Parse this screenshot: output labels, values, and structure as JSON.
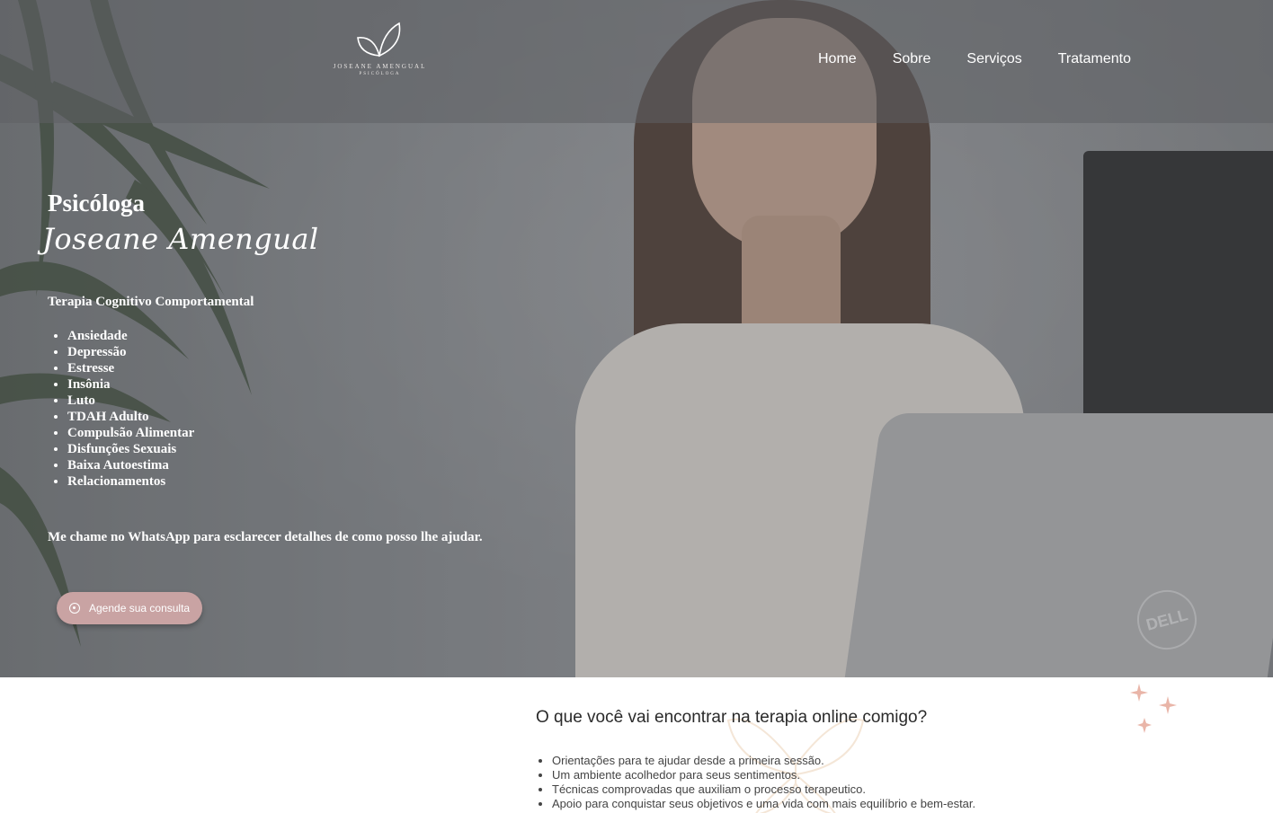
{
  "header": {
    "logo": {
      "name": "JOSEANE AMENGUAL",
      "subtitle": "PSICÓLOGA"
    },
    "nav": [
      {
        "label": "Home"
      },
      {
        "label": "Sobre"
      },
      {
        "label": "Serviços"
      },
      {
        "label": "Tratamento"
      }
    ]
  },
  "hero": {
    "title": "Psicóloga",
    "name": "Joseane Amengual",
    "subtitle": "Terapia Cognitivo Comportamental",
    "conditions": [
      "Ansiedade",
      "Depressão",
      "Estresse",
      "Insônia",
      "Luto",
      "TDAH Adulto",
      "Compulsão Alimentar",
      "Disfunções Sexuais",
      "Baixa Autoestima",
      "Relacionamentos"
    ],
    "cta_text": "Me chame no WhatsApp para esclarecer detalhes de como posso lhe ajudar.",
    "cta_button": "Agende sua consulta",
    "cta_icon": "whatsapp-icon",
    "laptop_brand": "DELL"
  },
  "section": {
    "title": "O que você vai encontrar na terapia online comigo?",
    "benefits": [
      "Orientações para te ajudar desde a primeira sessão.",
      "Um ambiente acolhedor para seus sentimentos.",
      "Técnicas comprovadas que auxiliam o processo terapeutico.",
      "Apoio para conquistar seus objetivos e uma vida com mais equilíbrio e bem-estar."
    ]
  },
  "colors": {
    "button": "#c9a3a3",
    "sparkle": "#e9b5a8",
    "header_overlay": "#5f6164"
  }
}
